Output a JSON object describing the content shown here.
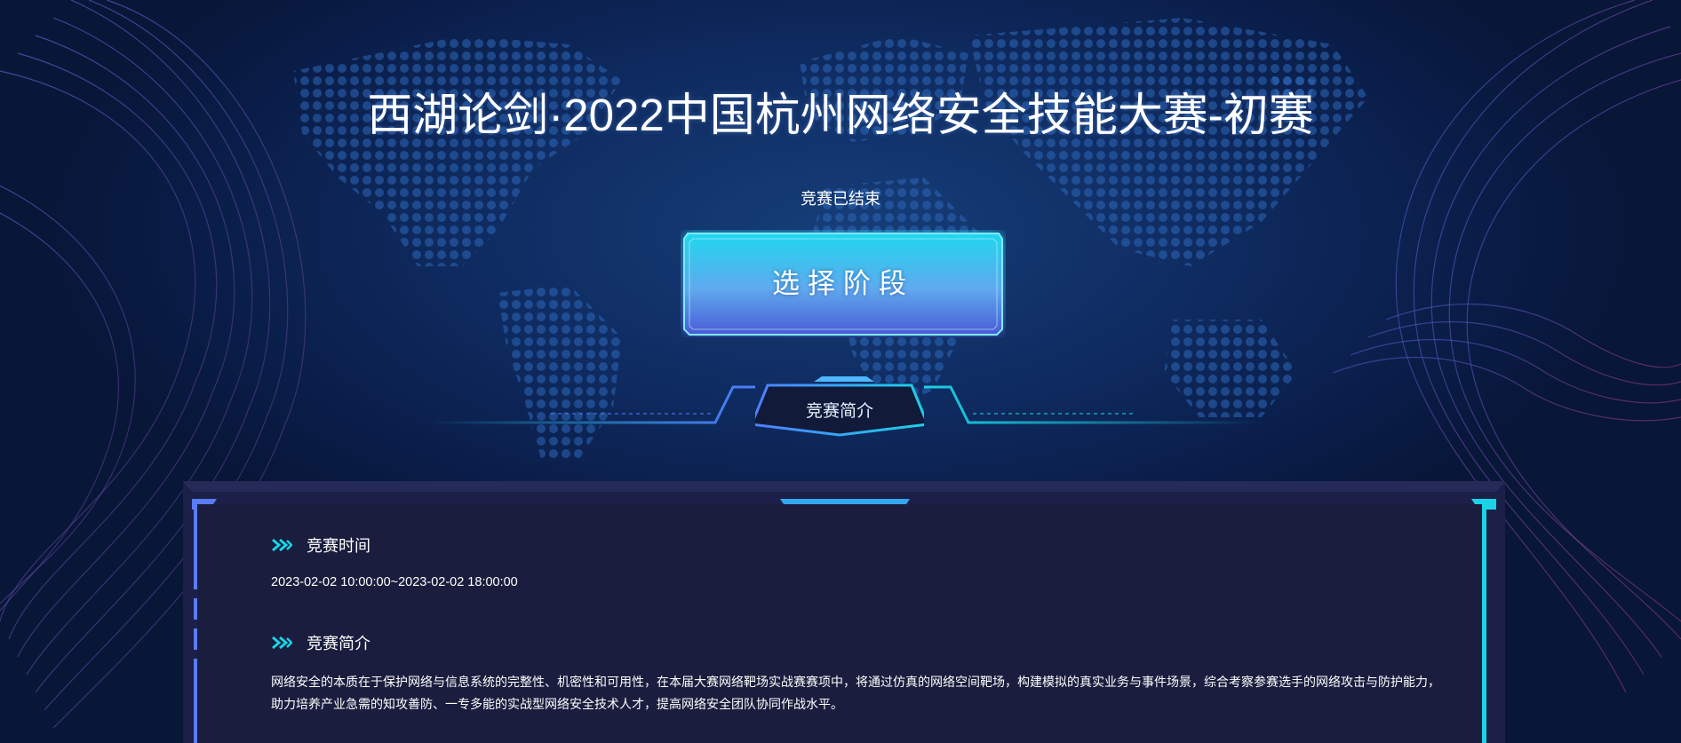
{
  "page": {
    "title": "西湖论剑·2022中国杭州网络安全技能大赛-初赛",
    "status": "竞赛已结束"
  },
  "stage_button": {
    "label": "选择阶段"
  },
  "tab": {
    "label": "竞赛简介"
  },
  "sections": {
    "time": {
      "heading": "竞赛时间",
      "value": "2023-02-02 10:00:00~2023-02-02 18:00:00"
    },
    "intro": {
      "heading": "竞赛简介",
      "text": "网络安全的本质在于保护网络与信息系统的完整性、机密性和可用性，在本届大赛网络靶场实战赛赛项中，将通过仿真的网络空间靶场，构建模拟的真实业务与事件场景，综合考察参赛选手的网络攻击与防护能力，助力培养产业急需的知攻善防、一专多能的实战型网络安全技术人才，提高网络安全团队协同作战水平。"
    }
  },
  "colors": {
    "accent_cyan": "#1ad3e6",
    "accent_blue": "#4f7dff",
    "panel_bg": "#1a1d3d",
    "page_bg": "#0b1f4c"
  },
  "icons": [
    "chevron-double-right-icon"
  ]
}
